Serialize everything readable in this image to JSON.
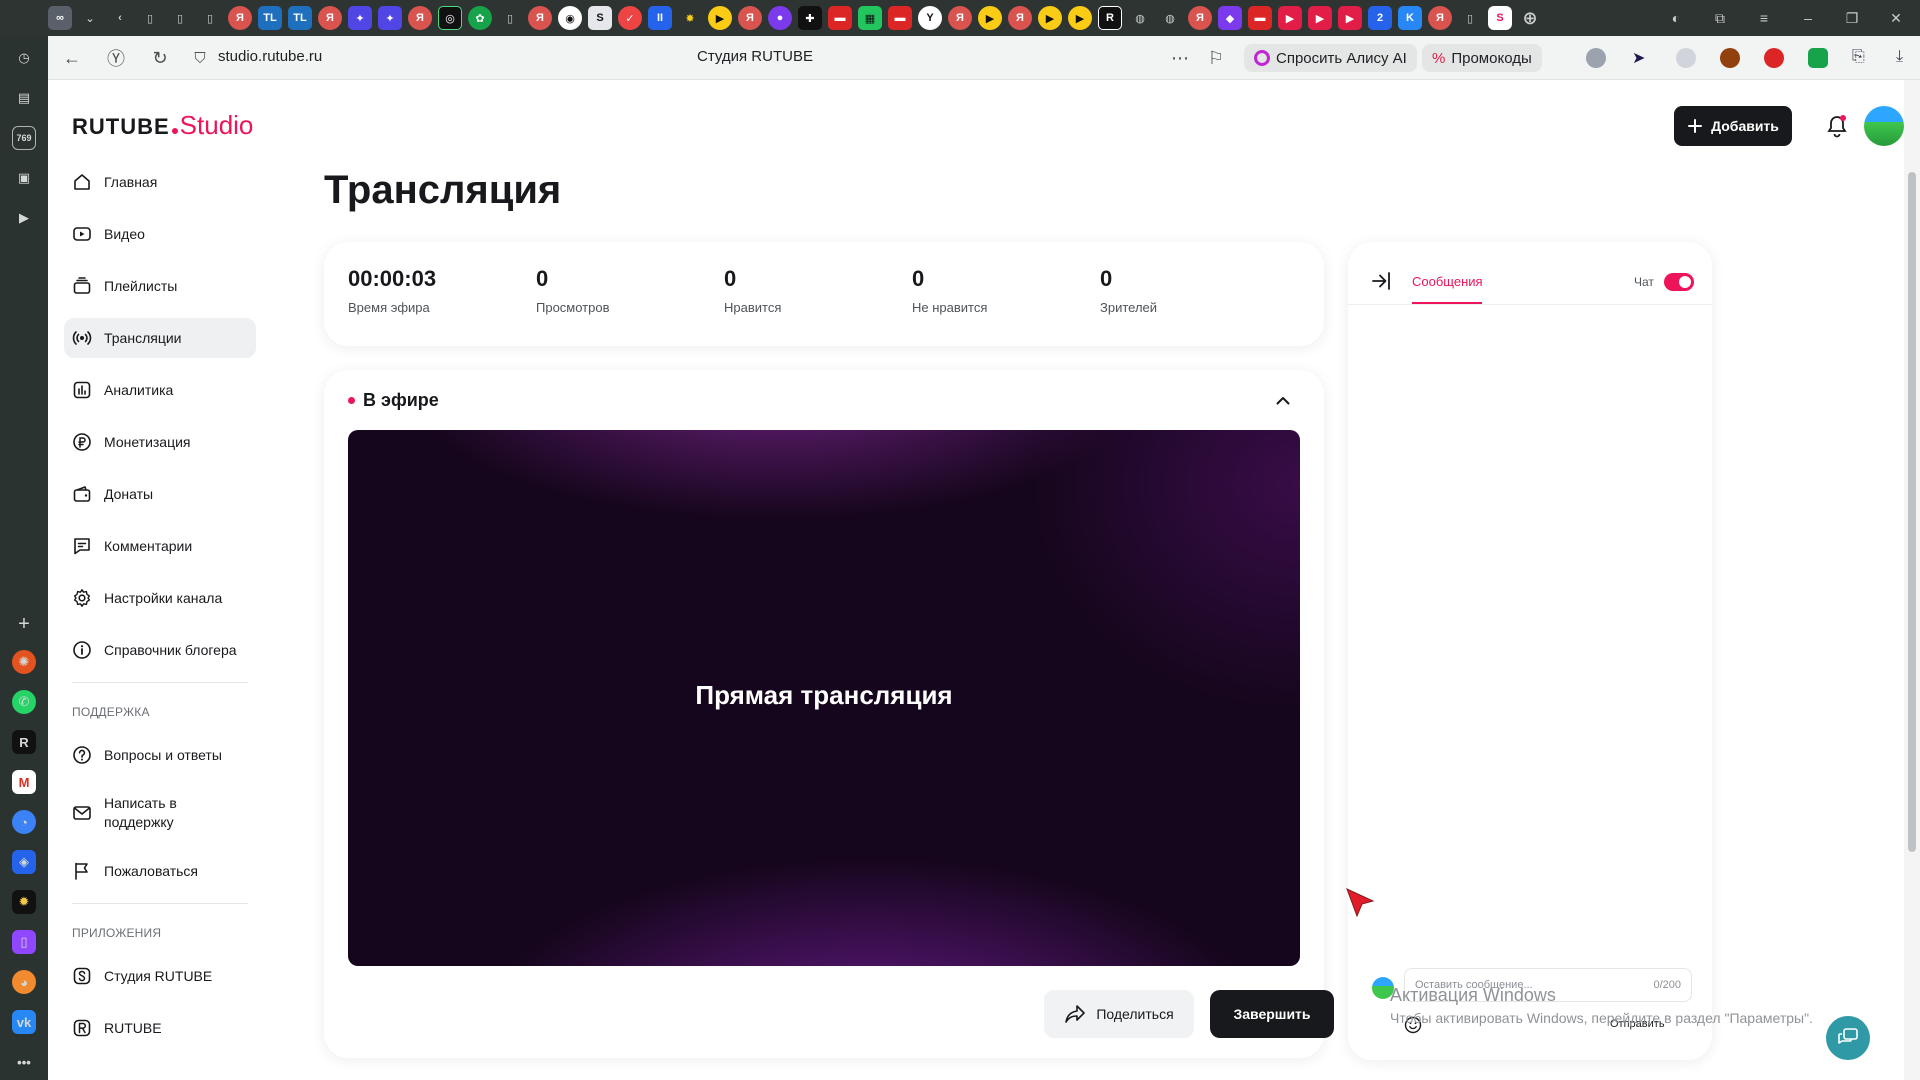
{
  "browser": {
    "url": "studio.rutube.ru",
    "page_title": "Студия RUTUBE",
    "alice_label": "Спросить Алису AI",
    "promo_label": "Промокоды"
  },
  "brand": {
    "name": "RUTUBE",
    "suffix": "Studio",
    "accent": "#ed1459"
  },
  "header": {
    "add_label": "Добавить"
  },
  "sidebar": {
    "items": [
      {
        "label": "Главная",
        "icon": "home-icon"
      },
      {
        "label": "Видео",
        "icon": "video-icon"
      },
      {
        "label": "Плейлисты",
        "icon": "playlist-icon"
      },
      {
        "label": "Трансляции",
        "icon": "broadcast-icon",
        "active": true
      },
      {
        "label": "Аналитика",
        "icon": "analytics-icon"
      },
      {
        "label": "Монетизация",
        "icon": "ruble-icon"
      },
      {
        "label": "Донаты",
        "icon": "wallet-icon"
      },
      {
        "label": "Комментарии",
        "icon": "comment-icon"
      },
      {
        "label": "Настройки канала",
        "icon": "gear-icon"
      },
      {
        "label": "Справочник блогера",
        "icon": "info-icon"
      }
    ],
    "support_title": "ПОДДЕРЖКА",
    "support_items": [
      {
        "label": "Вопросы и ответы",
        "icon": "question-icon"
      },
      {
        "label": "Написать в поддержку",
        "icon": "mail-icon"
      },
      {
        "label": "Пожаловаться",
        "icon": "flag-icon"
      }
    ],
    "apps_title": "ПРИЛОЖЕНИЯ",
    "apps_items": [
      {
        "label": "Студия RUTUBE",
        "icon": "studio-app-icon"
      },
      {
        "label": "RUTUBE",
        "icon": "rutube-app-icon"
      }
    ]
  },
  "page": {
    "title": "Трансляция"
  },
  "stats": [
    {
      "value": "00:00:03",
      "label": "Время эфира"
    },
    {
      "value": "0",
      "label": "Просмотров"
    },
    {
      "value": "0",
      "label": "Нравится"
    },
    {
      "value": "0",
      "label": "Не нравится"
    },
    {
      "value": "0",
      "label": "Зрителей"
    }
  ],
  "live": {
    "status": "В эфире",
    "player_text": "Прямая трансляция",
    "share_label": "Поделиться",
    "end_label": "Завершить"
  },
  "chat": {
    "tab_label": "Сообщения",
    "toggle_label": "Чат",
    "toggle_on": true,
    "input_placeholder": "Оставить сообщение...",
    "char_count": "0/200",
    "send_label": "Отправить"
  },
  "watermark": {
    "title": "Активация Windows",
    "text": "Чтобы активировать Windows, перейдите в раздел \"Параметры\"."
  }
}
